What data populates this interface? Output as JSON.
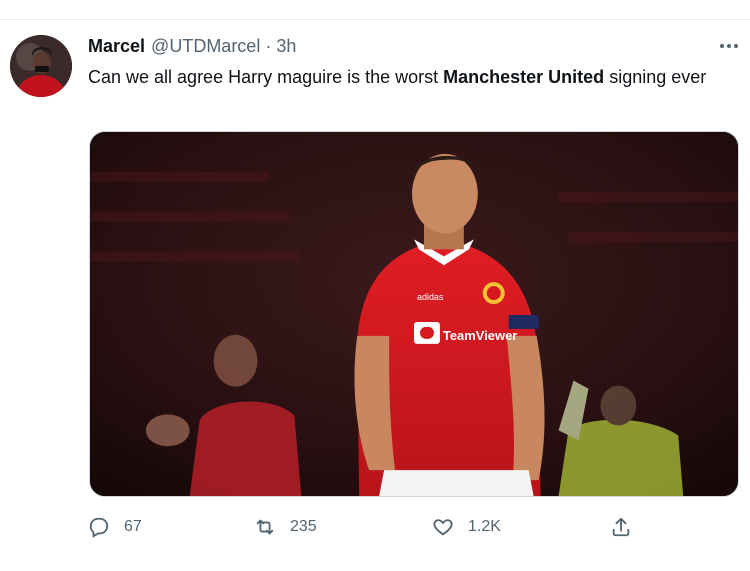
{
  "tweet": {
    "author_name": "Marcel",
    "handle": "@UTDMarcel",
    "separator": "·",
    "time": "3h",
    "text_part1": "Can we all agree Harry maguire is the worst ",
    "text_bold": "Manchester United",
    "text_part2": " signing ever",
    "media": {
      "jersey_sponsor": "TeamViewer",
      "jersey_brand": "adidas"
    }
  },
  "actions": {
    "reply_count": "67",
    "retweet_count": "235",
    "like_count": "1.2K"
  },
  "icons": {
    "more": "more-horizontal-icon",
    "reply": "reply-icon",
    "retweet": "retweet-icon",
    "like": "heart-icon",
    "share": "share-icon"
  },
  "colors": {
    "text": "#0f1419",
    "secondary": "#536471",
    "jersey_red": "#d7191f"
  }
}
